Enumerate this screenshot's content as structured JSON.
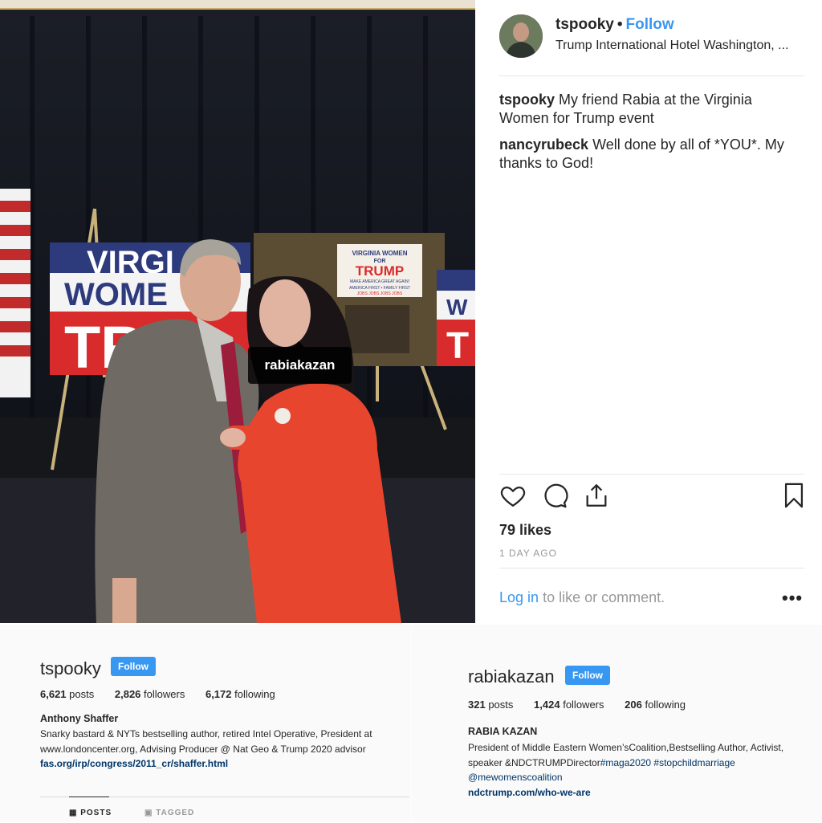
{
  "post": {
    "username": "tspooky",
    "dot": "•",
    "follow_label": "Follow",
    "location": "Trump International Hotel Washington, ...",
    "photo_tag": "rabiakazan",
    "photo_signs": {
      "sign1_line1": "VIRGI",
      "sign1_line2": "WOME",
      "sign1_line3": "TR",
      "sign2_line1": "VIRGINIA WOMEN",
      "sign2_line2": "FOR",
      "sign2_line3": "TRUMP",
      "sign2_line4": "MAKE AMERICA GREAT AGAIN!",
      "sign2_line5": "AMERICA FIRST • FAMILY FIRST",
      "sign2_line6": "JOBS JOBS JOBS JOBS",
      "sign3_line1": "W",
      "sign3_line2": "T"
    },
    "comments": [
      {
        "user": "tspooky",
        "text": "My friend Rabia at the Virginia Women for Trump event"
      },
      {
        "user": "nancyrubeck",
        "text": "Well done by all of *YOU*. My thanks to God!"
      }
    ],
    "likes": "79 likes",
    "time": "1 DAY AGO",
    "login_link": "Log in",
    "login_rest": "to like or comment.",
    "more": "•••"
  },
  "profile_left": {
    "username": "tspooky",
    "follow_label": "Follow",
    "posts_count": "6,621",
    "posts_label": "posts",
    "followers_count": "2,826",
    "followers_label": "followers",
    "following_count": "6,172",
    "following_label": "following",
    "name": "Anthony Shaffer",
    "bio_line1": "Snarky bastard & NYTs bestselling author, retired Intel Operative, President at",
    "bio_line2": "www.londoncenter.org, Advising Producer @ Nat Geo & Trump 2020 advisor",
    "link": "fas.org/irp/congress/2011_cr/shaffer.html",
    "tab_posts": "POSTS",
    "tab_tagged": "TAGGED"
  },
  "profile_right": {
    "username": "rabiakazan",
    "follow_label": "Follow",
    "posts_count": "321",
    "posts_label": "posts",
    "followers_count": "1,424",
    "followers_label": "followers",
    "following_count": "206",
    "following_label": "following",
    "name": "RABIA KAZAN",
    "bio_line1": "President of Middle Eastern Women’sCoalition,Bestselling Author, Activist,",
    "bio_line2_a": "speaker &NDCTRUMPDirector",
    "bio_line2_b": "#maga2020 #stopchildmarriage",
    "bio_line3": "@mewomenscoalition",
    "link": "ndctrump.com/who-we-are"
  },
  "colors": {
    "accent": "#3897f0",
    "link": "#003569",
    "sign_red": "#d92b2b",
    "sign_blue": "#2d3a7c",
    "coat": "#e8452f",
    "tie": "#9c1c3c"
  }
}
